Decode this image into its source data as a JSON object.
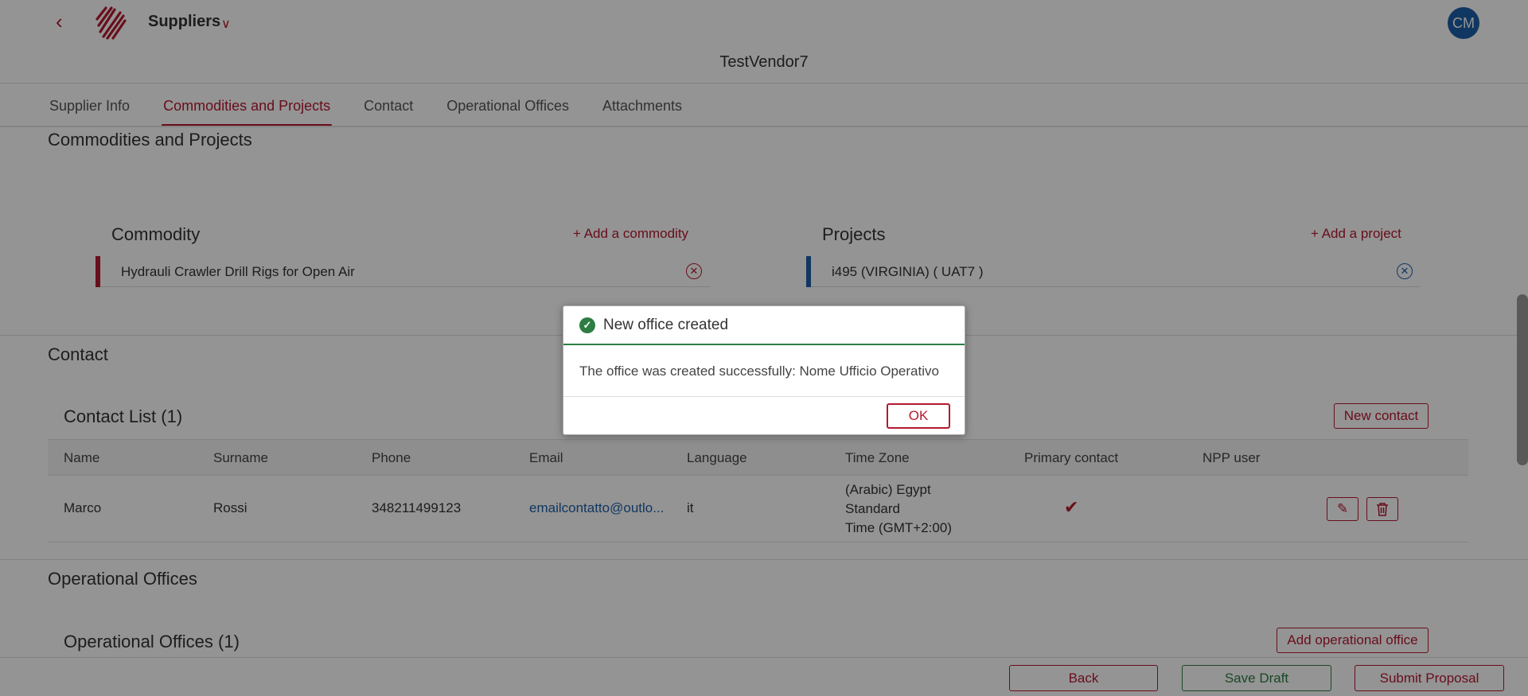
{
  "header": {
    "app_title": "Suppliers",
    "avatar_initials": "CM",
    "vendor_name": "TestVendor7"
  },
  "tabs": [
    {
      "label": "Supplier Info",
      "active": false
    },
    {
      "label": "Commodities and Projects",
      "active": true
    },
    {
      "label": "Contact",
      "active": false
    },
    {
      "label": "Operational Offices",
      "active": false
    },
    {
      "label": "Attachments",
      "active": false
    }
  ],
  "commodities_section": {
    "title": "Commodities and Projects",
    "commodity": {
      "title": "Commodity",
      "add_label": "+ Add a commodity",
      "items": [
        "Hydrauli Crawler Drill Rigs for Open Air"
      ]
    },
    "projects": {
      "title": "Projects",
      "add_label": "+ Add a project",
      "items": [
        "i495 (VIRGINIA) ( UAT7 )"
      ]
    }
  },
  "contact_section": {
    "title": "Contact",
    "list_title": "Contact List (1)",
    "new_button": "New contact",
    "columns": [
      "Name",
      "Surname",
      "Phone",
      "Email",
      "Language",
      "Time Zone",
      "Primary contact",
      "NPP user"
    ],
    "rows": [
      {
        "name": "Marco",
        "surname": "Rossi",
        "phone": "348211499123",
        "email": "emailcontatto@outlo...",
        "language": "it",
        "timezone_lines": [
          "(Arabic) Egypt",
          "Standard",
          "Time (GMT+2:00)"
        ],
        "primary": true,
        "npp_user": ""
      }
    ]
  },
  "offices_section": {
    "title": "Operational Offices",
    "list_title": "Operational Offices (1)",
    "add_button": "Add operational office"
  },
  "footer": {
    "back": "Back",
    "save_draft": "Save Draft",
    "submit": "Submit Proposal"
  },
  "modal": {
    "title": "New office created",
    "message": "The office was created successfully: Nome Ufficio Operativo",
    "ok": "OK"
  },
  "colors": {
    "brand_red": "#b5192f",
    "link_blue": "#1d5fa8",
    "success_green": "#2e7d43"
  }
}
